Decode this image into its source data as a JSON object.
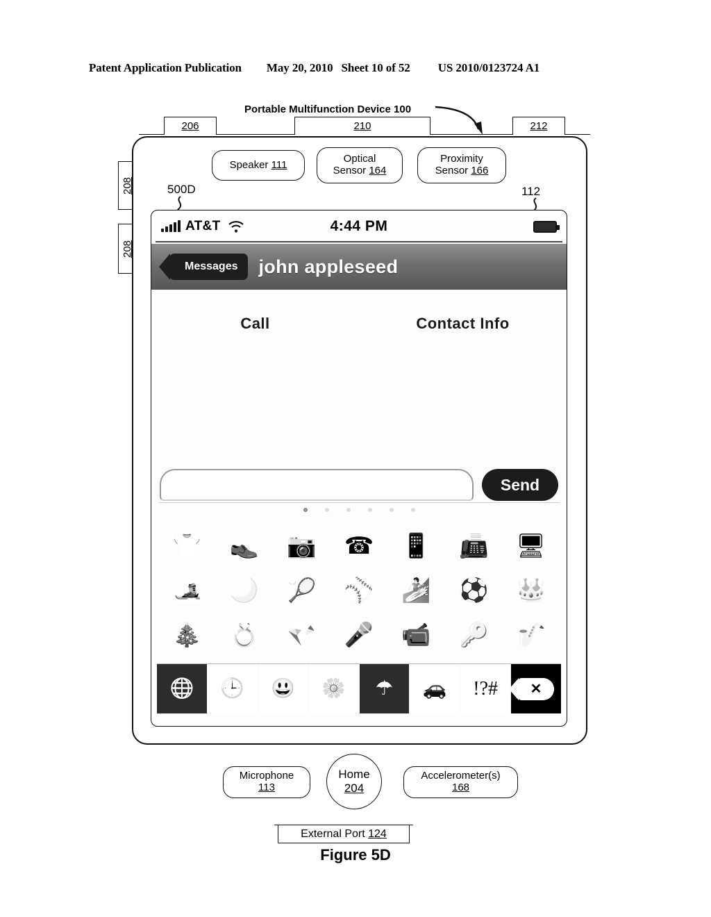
{
  "patent_header": {
    "publication": "Patent Application Publication",
    "date": "May 20, 2010",
    "sheet": "Sheet 10 of 52",
    "number": "US 2010/0123724 A1"
  },
  "figure": {
    "caption": "Figure 5D",
    "device_title": "Portable Multifunction Device 100",
    "variant_label": "500D",
    "touchscreen_ref": "112"
  },
  "reference_numerals": {
    "top_left": "206",
    "top_center": "210",
    "top_right": "212",
    "side_upper": "208",
    "side_lower": "208"
  },
  "hardware": {
    "speaker": {
      "name": "Speaker",
      "ref": "111"
    },
    "optical_sensor": {
      "name": "Optical",
      "name2": "Sensor",
      "ref": "164"
    },
    "proximity_sensor": {
      "name": "Proximity",
      "name2": "Sensor",
      "ref": "166"
    },
    "microphone": {
      "name": "Microphone",
      "ref": "113"
    },
    "home_button": {
      "name": "Home",
      "ref": "204"
    },
    "accelerometer": {
      "name": "Accelerometer(s)",
      "ref": "168"
    },
    "external_port": {
      "name": "External Port",
      "ref": "124"
    }
  },
  "screen": {
    "status_bar": {
      "signal_icon": "signal-bars-icon",
      "carrier": "AT&T",
      "wifi_icon": "wifi-icon",
      "time": "4:44 PM",
      "battery_icon": "battery-icon"
    },
    "nav_bar": {
      "back_icon": "chevron-left-icon",
      "back_label": "Messages",
      "title": "john appleseed"
    },
    "actions": [
      {
        "label": "Call"
      },
      {
        "label": "Contact Info"
      }
    ],
    "composer": {
      "input_value": "",
      "input_placeholder": "",
      "send_label": "Send"
    },
    "page_dots": {
      "count": 6,
      "active_index": 0
    },
    "emoji_grid": [
      {
        "name": "tshirt-emoji",
        "glyph": "👕"
      },
      {
        "name": "shoe-emoji",
        "glyph": "👞"
      },
      {
        "name": "camera-emoji",
        "glyph": "📷"
      },
      {
        "name": "telephone-emoji",
        "glyph": "☎"
      },
      {
        "name": "mobile-phone-emoji",
        "glyph": "📱"
      },
      {
        "name": "fax-machine-emoji",
        "glyph": "📠"
      },
      {
        "name": "computer-monitor-emoji",
        "glyph": "🖥"
      },
      {
        "name": "skis-emoji",
        "glyph": "🎿"
      },
      {
        "name": "golf-ball-emoji",
        "glyph": "🌙"
      },
      {
        "name": "tennis-ball-emoji",
        "glyph": "🎾"
      },
      {
        "name": "baseball-emoji",
        "glyph": "⚾"
      },
      {
        "name": "surfboard-emoji",
        "glyph": "🏄"
      },
      {
        "name": "soccer-ball-emoji",
        "glyph": "⚽"
      },
      {
        "name": "crown-emoji",
        "glyph": "👑"
      },
      {
        "name": "christmas-tree-emoji",
        "glyph": "🎄"
      },
      {
        "name": "ring-emoji",
        "glyph": "💍"
      },
      {
        "name": "gem-emoji",
        "glyph": "💎"
      },
      {
        "name": "microphone-emoji",
        "glyph": "🎤"
      },
      {
        "name": "video-camera-emoji",
        "glyph": "📹"
      },
      {
        "name": "key-emoji",
        "glyph": "🔑"
      },
      {
        "name": "saxophone-emoji",
        "glyph": "🎷"
      }
    ],
    "tab_bar": [
      {
        "name": "globe-tab-icon",
        "glyph": "🌐",
        "selected": true,
        "style": "dark"
      },
      {
        "name": "clock-tab-icon",
        "glyph": "🕒",
        "selected": false,
        "style": "light"
      },
      {
        "name": "smiley-tab-icon",
        "glyph": "😃",
        "selected": false,
        "style": "light"
      },
      {
        "name": "flower-tab-icon",
        "glyph": "🌼",
        "selected": false,
        "style": "light"
      },
      {
        "name": "umbrella-tab-icon",
        "glyph": "☂",
        "selected": true,
        "style": "dark"
      },
      {
        "name": "car-tab-icon",
        "glyph": "🚗",
        "selected": false,
        "style": "light"
      },
      {
        "name": "symbols-tab-icon",
        "glyph": "!?#",
        "selected": false,
        "style": "light"
      },
      {
        "name": "delete-key-icon",
        "glyph": "✕",
        "selected": false,
        "style": "delete"
      }
    ]
  }
}
